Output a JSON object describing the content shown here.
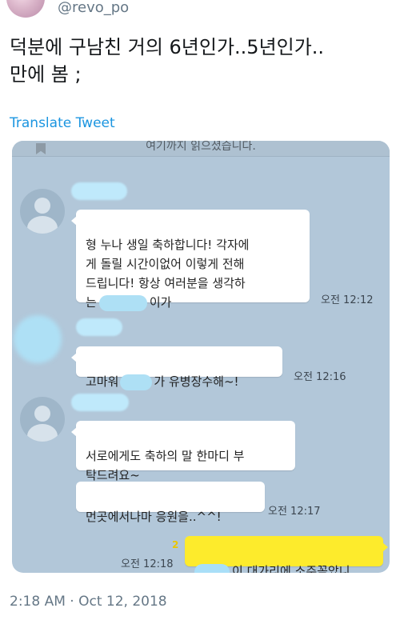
{
  "tweet": {
    "handle": "@revo_po",
    "text": "덕분에 구남친 거의 6년인가..5년인가..\n만에 봄 ;",
    "translate_label": "Translate Tweet",
    "timestamp": "2:18 AM · Oct 12, 2018"
  },
  "chat": {
    "notice": "여기까지 읽으셨습니다.",
    "messages": [
      {
        "text_main": "형 누나 생일 축하합니다! 각자에\n게 돌릴 시간이없어 이렇게 전해\n드립니다! 항상 여러분을 생각하\n는",
        "text_tail": "이가",
        "time": "오전 12:12"
      },
      {
        "text_pre": "고마워",
        "text_post": "가 유병장수해~!",
        "time": "오전 12:16"
      },
      {
        "text": "서로에게도 축하의 말 한마디 부\n탁드려요~",
        "time": ""
      },
      {
        "text": "먼곳에서나마 응원을..^^!",
        "time": "오전 12:17"
      },
      {
        "read_count": "2",
        "time": "오전 12:18",
        "text_post": "이 대가리에 소주꽂았니"
      }
    ]
  },
  "colors": {
    "chat_bg": "#b2c7d9",
    "my_bubble": "#fdeb2c",
    "link": "#1b95e0",
    "muted": "#657786"
  }
}
